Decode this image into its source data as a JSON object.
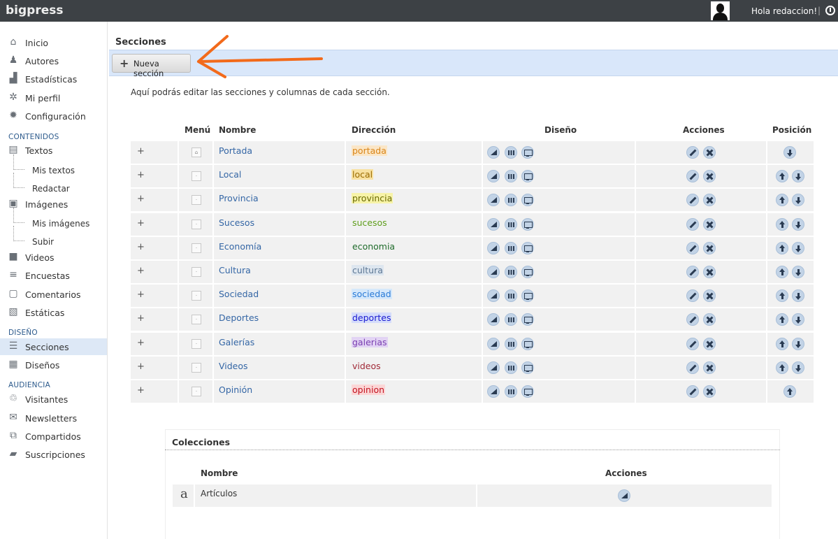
{
  "app": {
    "brand": "bigpress",
    "greeting": "Hola redaccion!",
    "separator": "|"
  },
  "sidebar": {
    "items": [
      {
        "label": "Inicio",
        "icon": "home-icon"
      },
      {
        "label": "Autores",
        "icon": "users-icon"
      },
      {
        "label": "Estadísticas",
        "icon": "stats-icon"
      },
      {
        "label": "Mi perfil",
        "icon": "gears-icon"
      },
      {
        "label": "Configuración",
        "icon": "gear-icon"
      }
    ],
    "sections": [
      {
        "heading": "CONTENIDOS"
      },
      {
        "heading": "DISEÑO"
      },
      {
        "heading": "AUDIENCIA"
      }
    ],
    "contenidos": [
      {
        "label": "Textos",
        "icon": "document-icon"
      },
      {
        "label": "Mis textos"
      },
      {
        "label": "Redactar"
      },
      {
        "label": "Imágenes",
        "icon": "image-icon"
      },
      {
        "label": "Mis imágenes"
      },
      {
        "label": "Subir"
      },
      {
        "label": "Videos",
        "icon": "video-icon"
      },
      {
        "label": "Encuestas",
        "icon": "poll-icon"
      },
      {
        "label": "Comentarios",
        "icon": "comment-icon"
      },
      {
        "label": "Estáticas",
        "icon": "static-page-icon"
      }
    ],
    "diseno": [
      {
        "label": "Secciones",
        "icon": "list-icon",
        "active": true
      },
      {
        "label": "Diseños",
        "icon": "grid-icon"
      }
    ],
    "audiencia": [
      {
        "label": "Visitantes",
        "icon": "visitors-icon"
      },
      {
        "label": "Newsletters",
        "icon": "newsletter-icon"
      },
      {
        "label": "Compartidos",
        "icon": "share-icon"
      },
      {
        "label": "Suscripciones",
        "icon": "briefcase-icon"
      }
    ]
  },
  "main": {
    "title": "Secciones",
    "new_button": "Nueva sección",
    "intro": "Aquí podrás editar las secciones y columnas de cada sección.",
    "columns": {
      "menu": "Menú",
      "name": "Nombre",
      "address": "Dirección",
      "design": "Diseño",
      "actions": "Acciones",
      "position": "Posición"
    },
    "expand_symbol": "+",
    "sections": [
      {
        "name": "Portada",
        "slug": "portada",
        "color": "#d9861a",
        "bg": "#fbe6c6",
        "home": true,
        "up": false,
        "down": true
      },
      {
        "name": "Local",
        "slug": "local",
        "color": "#9a6b00",
        "bg": "#f8e1a0",
        "up": true,
        "down": true
      },
      {
        "name": "Provincia",
        "slug": "provincia",
        "color": "#6b6b00",
        "bg": "#f7f3a8",
        "up": true,
        "down": true
      },
      {
        "name": "Sucesos",
        "slug": "sucesos",
        "color": "#5f9e1c",
        "bg": "",
        "up": true,
        "down": true
      },
      {
        "name": "Economía",
        "slug": "economia",
        "color": "#1f6b2b",
        "bg": "",
        "up": true,
        "down": true
      },
      {
        "name": "Cultura",
        "slug": "cultura",
        "color": "#5d7794",
        "bg": "#dde6ef",
        "up": true,
        "down": true
      },
      {
        "name": "Sociedad",
        "slug": "sociedad",
        "color": "#2a7ad6",
        "bg": "#d5e8fb",
        "up": true,
        "down": true
      },
      {
        "name": "Deportes",
        "slug": "deportes",
        "color": "#1a1ad0",
        "bg": "#d4dcfb",
        "up": true,
        "down": true
      },
      {
        "name": "Galerías",
        "slug": "galerias",
        "color": "#7a3fb0",
        "bg": "#e2d3f4",
        "up": true,
        "down": true
      },
      {
        "name": "Videos",
        "slug": "videos",
        "color": "#a02a38",
        "bg": "",
        "up": true,
        "down": true
      },
      {
        "name": "Opinión",
        "slug": "opinion",
        "color": "#c2121f",
        "bg": "#fbd6d6",
        "up": true,
        "down": false
      }
    ]
  },
  "collections": {
    "title": "Colecciones",
    "columns": {
      "name": "Nombre",
      "actions": "Acciones"
    },
    "rows": [
      {
        "letter": "a",
        "name": "Artículos"
      }
    ]
  },
  "colors": {
    "topbar": "#3d4145",
    "toolbar": "#d9e7fa",
    "accent_arrow": "#f26a1b",
    "link": "#3466a5"
  }
}
